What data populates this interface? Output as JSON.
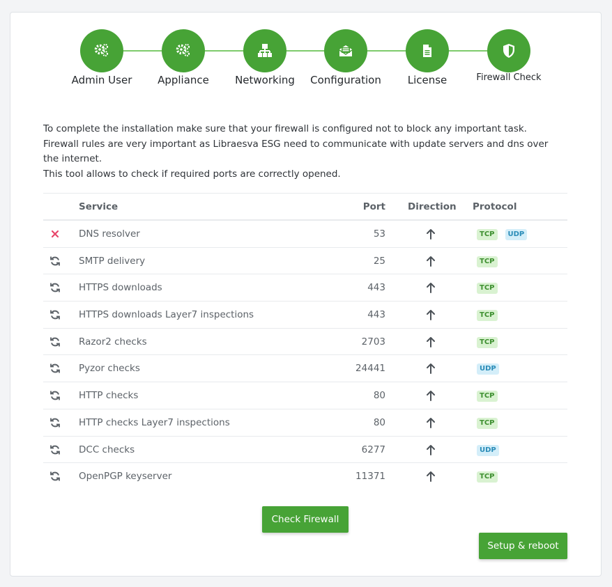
{
  "wizard": {
    "steps": [
      {
        "label": "Admin User",
        "icon": "gears-icon"
      },
      {
        "label": "Appliance",
        "icon": "gears-icon"
      },
      {
        "label": "Networking",
        "icon": "network-icon"
      },
      {
        "label": "Configuration",
        "icon": "envelope-open-icon"
      },
      {
        "label": "License",
        "icon": "document-icon"
      },
      {
        "label": "Firewall Check",
        "icon": "shield-icon"
      }
    ],
    "active_step": 5,
    "color": "#47a336"
  },
  "intro": {
    "line1": "To complete the installation make sure that your firewall is configured not to block any important task.",
    "line2": "Firewall rules are very important as Libraesva ESG need to communicate with update servers and dns over the internet.",
    "line3": "This tool allows to check if required ports are correctly opened."
  },
  "table": {
    "headers": {
      "service": "Service",
      "port": "Port",
      "direction": "Direction",
      "protocol": "Protocol"
    },
    "rows": [
      {
        "status": "failed",
        "service": "DNS resolver",
        "port": "53",
        "direction": "outbound",
        "protocols": [
          "TCP",
          "UDP"
        ]
      },
      {
        "status": "pending",
        "service": "SMTP delivery",
        "port": "25",
        "direction": "outbound",
        "protocols": [
          "TCP"
        ]
      },
      {
        "status": "pending",
        "service": "HTTPS downloads",
        "port": "443",
        "direction": "outbound",
        "protocols": [
          "TCP"
        ]
      },
      {
        "status": "pending",
        "service": "HTTPS downloads Layer7 inspections",
        "port": "443",
        "direction": "outbound",
        "protocols": [
          "TCP"
        ]
      },
      {
        "status": "pending",
        "service": "Razor2 checks",
        "port": "2703",
        "direction": "outbound",
        "protocols": [
          "TCP"
        ]
      },
      {
        "status": "pending",
        "service": "Pyzor checks",
        "port": "24441",
        "direction": "outbound",
        "protocols": [
          "UDP"
        ]
      },
      {
        "status": "pending",
        "service": "HTTP checks",
        "port": "80",
        "direction": "outbound",
        "protocols": [
          "TCP"
        ]
      },
      {
        "status": "pending",
        "service": "HTTP checks Layer7 inspections",
        "port": "80",
        "direction": "outbound",
        "protocols": [
          "TCP"
        ]
      },
      {
        "status": "pending",
        "service": "DCC checks",
        "port": "6277",
        "direction": "outbound",
        "protocols": [
          "UDP"
        ]
      },
      {
        "status": "pending",
        "service": "OpenPGP keyserver",
        "port": "11371",
        "direction": "outbound",
        "protocols": [
          "TCP"
        ]
      }
    ]
  },
  "buttons": {
    "check_firewall": "Check Firewall",
    "setup_reboot": "Setup & reboot"
  },
  "colors": {
    "accent": "#47a336",
    "failed": "#e8476b",
    "tcp_bg": "#d9f2d1",
    "udp_bg": "#d4eef9"
  }
}
